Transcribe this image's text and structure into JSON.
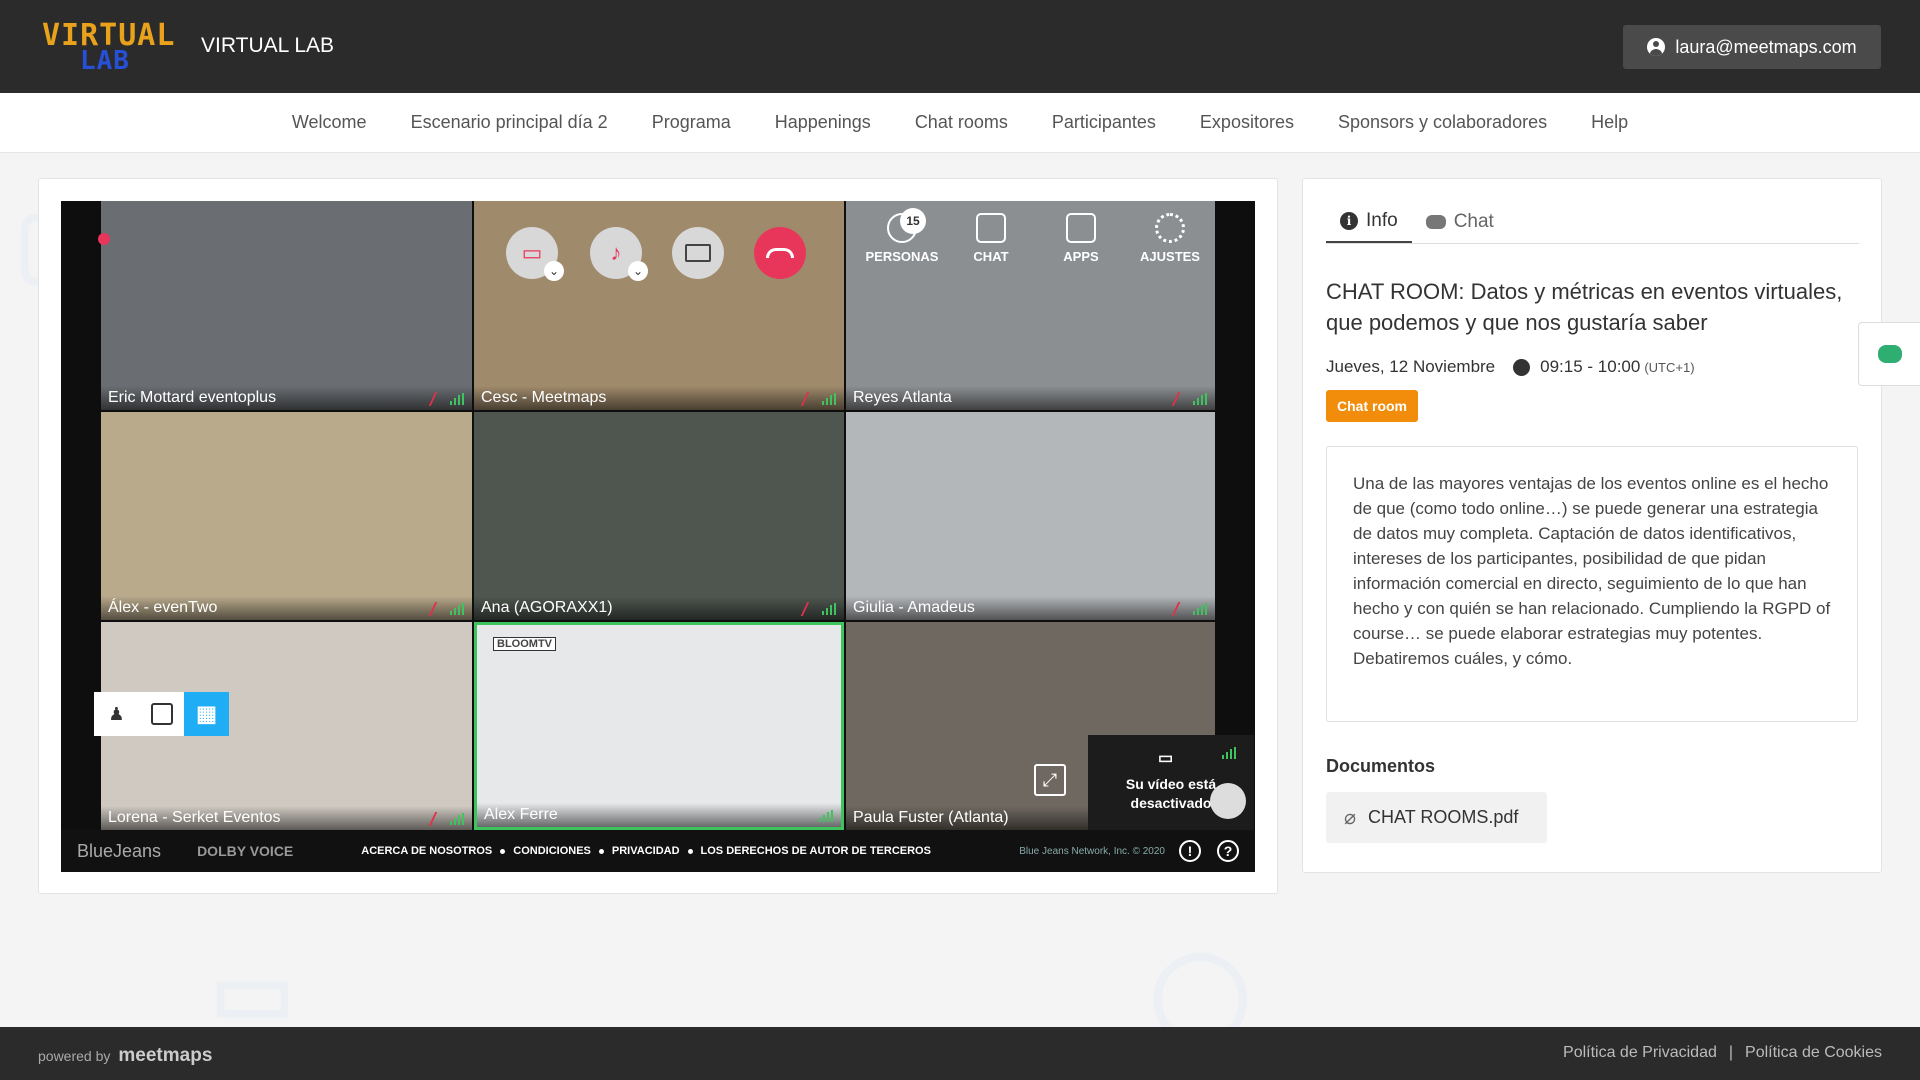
{
  "header": {
    "logo_line1": "VIRTUAL",
    "logo_line2": "LAB",
    "title": "VIRTUAL LAB",
    "user_email": "laura@meetmaps.com"
  },
  "nav": [
    "Welcome",
    "Escenario principal día 2",
    "Programa",
    "Happenings",
    "Chat rooms",
    "Participantes",
    "Expositores",
    "Sponsors y colaboradores",
    "Help"
  ],
  "video": {
    "participants": [
      {
        "name": "Eric Mottard eventoplus",
        "bg": "#6a6e72"
      },
      {
        "name": "Cesc - Meetmaps",
        "bg": "#a08a6c"
      },
      {
        "name": "Reyes Atlanta",
        "bg": "#8c8f92"
      },
      {
        "name": "Álex - evenTwo",
        "bg": "#b9aa8c"
      },
      {
        "name": "Ana (AGORAXX1)",
        "bg": "#4f5650"
      },
      {
        "name": "Giulia - Amadeus",
        "bg": "#b4b7ba"
      },
      {
        "name": "Lorena - Serket Eventos",
        "bg": "#cfc9c1"
      },
      {
        "name": "Alex Ferre",
        "bg": "#e6e8ea"
      },
      {
        "name": "Paula Fuster (Atlanta)",
        "bg": "#6e6860"
      }
    ],
    "bloom_tag": "BLOOMTV",
    "controls": {
      "people_label": "PERSONAS",
      "people_count": "15",
      "chat_label": "CHAT",
      "apps_label": "APPS",
      "settings_label": "AJUSTES"
    },
    "selfview_text_1": "Su vídeo está",
    "selfview_text_2": "desactivado",
    "footer": {
      "brand": "BlueJeans",
      "dolby": "DOLBY VOICE",
      "links": [
        "ACERCA DE NOSOTROS",
        "CONDICIONES",
        "PRIVACIDAD",
        "LOS DERECHOS DE AUTOR DE TERCEROS"
      ],
      "copyright": "Blue Jeans Network, Inc. © 2020",
      "alert_glyph": "!",
      "help_glyph": "?"
    }
  },
  "info": {
    "tab_info": "Info",
    "tab_info_glyph": "i",
    "tab_chat": "Chat",
    "room_title": "CHAT ROOM: Datos y métricas en eventos virtuales, que podemos y que nos gustaría saber",
    "date": "Jueves, 12 Noviembre",
    "time": "09:15 - 10:00",
    "timezone": "(UTC+1)",
    "pill": "Chat room",
    "description": "Una de las mayores ventajas de los eventos online es el hecho de que (como todo online…) se puede generar una estrategia de datos muy completa. Captación de datos identificativos, intereses de los participantes, posibilidad de que pidan información comercial en directo, seguimiento de lo que han hecho y con quién se han relacionado. Cumpliendo la RGPD of course… se puede elaborar estrategias muy potentes. Debatiremos cuáles, y cómo.",
    "docs_heading": "Documentos",
    "doc_name": "CHAT ROOMS.pdf"
  },
  "footer": {
    "powered_by": "powered by",
    "brand": "meetmaps",
    "privacy": "Política de Privacidad",
    "separator": "|",
    "cookies": "Política de Cookies"
  },
  "colors": {
    "accent_orange": "#f28c0b",
    "hangup": "#e8365b",
    "active_layout": "#1faef5",
    "speaker_border": "#3ec35f"
  }
}
